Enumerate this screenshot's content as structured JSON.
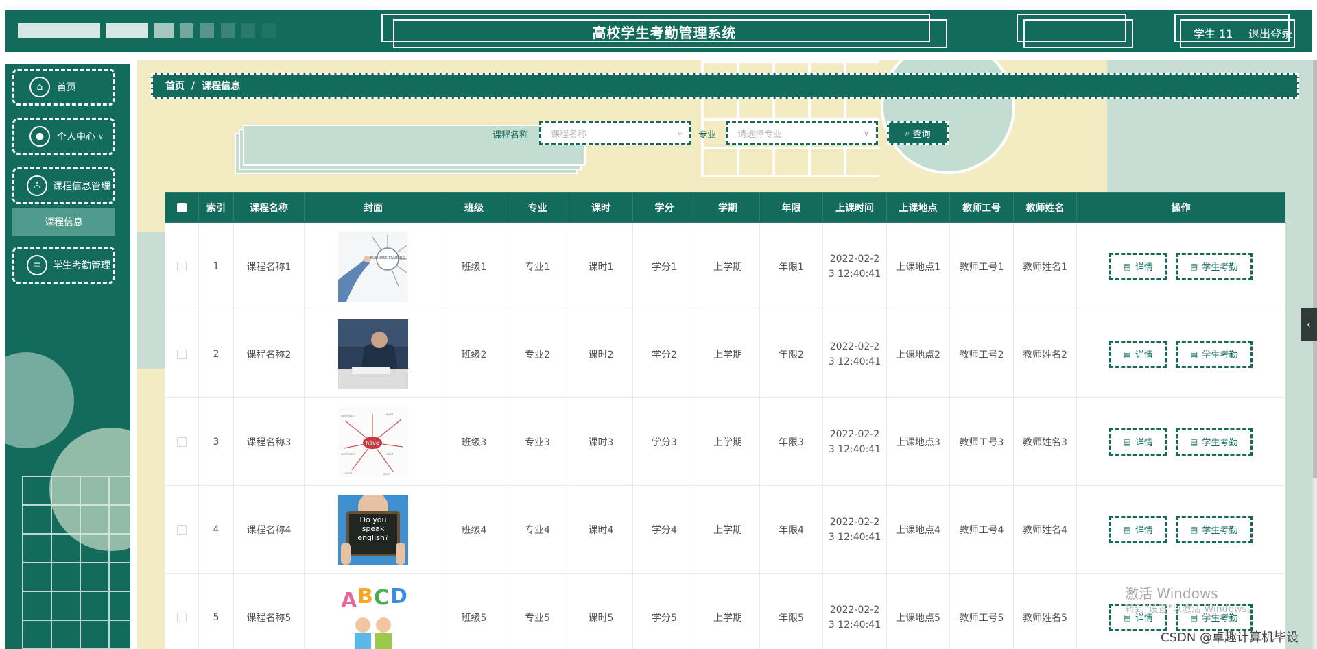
{
  "header": {
    "title": "高校学生考勤管理系统",
    "user": "学生 11",
    "logout": "退出登录"
  },
  "sidebar": {
    "items": [
      {
        "label": "首页",
        "icon": "home-icon"
      },
      {
        "label": "个人中心",
        "icon": "user-icon",
        "chevron": "chevron-down-icon"
      },
      {
        "label": "课程信息管理",
        "icon": "person-icon"
      },
      {
        "label": "学生考勤管理",
        "icon": "list-icon"
      }
    ],
    "submenu": {
      "label": "课程信息"
    }
  },
  "breadcrumb": {
    "home": "首页",
    "separator": "/",
    "current": "课程信息"
  },
  "search": {
    "course_label": "课程名称",
    "course_placeholder": "课程名称",
    "major_label": "专业",
    "major_placeholder": "请选择专业",
    "button": "查询"
  },
  "table": {
    "columns": [
      "索引",
      "课程名称",
      "封面",
      "班级",
      "专业",
      "课时",
      "学分",
      "学期",
      "年限",
      "上课时间",
      "上课地点",
      "教师工号",
      "教师姓名",
      "操作"
    ],
    "rows": [
      {
        "index": "1",
        "course": "课程名称1",
        "cover": "cover-1",
        "class": "班级1",
        "major": "专业1",
        "hours": "课时1",
        "credit": "学分1",
        "term": "上学期",
        "years": "年限1",
        "time": "2022-02-23 12:40:41",
        "place": "上课地点1",
        "teacher_id": "教师工号1",
        "teacher_name": "教师姓名1"
      },
      {
        "index": "2",
        "course": "课程名称2",
        "cover": "cover-2",
        "class": "班级2",
        "major": "专业2",
        "hours": "课时2",
        "credit": "学分2",
        "term": "上学期",
        "years": "年限2",
        "time": "2022-02-23 12:40:41",
        "place": "上课地点2",
        "teacher_id": "教师工号2",
        "teacher_name": "教师姓名2"
      },
      {
        "index": "3",
        "course": "课程名称3",
        "cover": "cover-3",
        "class": "班级3",
        "major": "专业3",
        "hours": "课时3",
        "credit": "学分3",
        "term": "上学期",
        "years": "年限3",
        "time": "2022-02-23 12:40:41",
        "place": "上课地点3",
        "teacher_id": "教师工号3",
        "teacher_name": "教师姓名3"
      },
      {
        "index": "4",
        "course": "课程名称4",
        "cover": "cover-4",
        "class": "班级4",
        "major": "专业4",
        "hours": "课时4",
        "credit": "学分4",
        "term": "上学期",
        "years": "年限4",
        "time": "2022-02-23 12:40:41",
        "place": "上课地点4",
        "teacher_id": "教师工号4",
        "teacher_name": "教师姓名4"
      },
      {
        "index": "5",
        "course": "课程名称5",
        "cover": "cover-5",
        "class": "班级5",
        "major": "专业5",
        "hours": "课时5",
        "credit": "学分5",
        "term": "上学期",
        "years": "年限5",
        "time": "2022-02-23 12:40:41",
        "place": "上课地点5",
        "teacher_id": "教师工号5",
        "teacher_name": "教师姓名5"
      }
    ],
    "actions": {
      "detail": "详情",
      "attendance": "学生考勤"
    },
    "cover_texts": {
      "cover-1": "BUSINESS TRAINING",
      "cover-3": "have",
      "cover-4": "Do you speak english?",
      "cover-5": "ABCD"
    }
  },
  "overlay": {
    "watermark_title": "激活 Windows",
    "watermark_sub": "转到\"设置\"以激活 Windows。",
    "csdn": "CSDN @卓趣计算机毕设"
  },
  "colors": {
    "primary": "#136b5c",
    "sidebar_active": "#4f9a8a",
    "background": "#f3ecc2",
    "accent_light": "#c4ddd1"
  }
}
